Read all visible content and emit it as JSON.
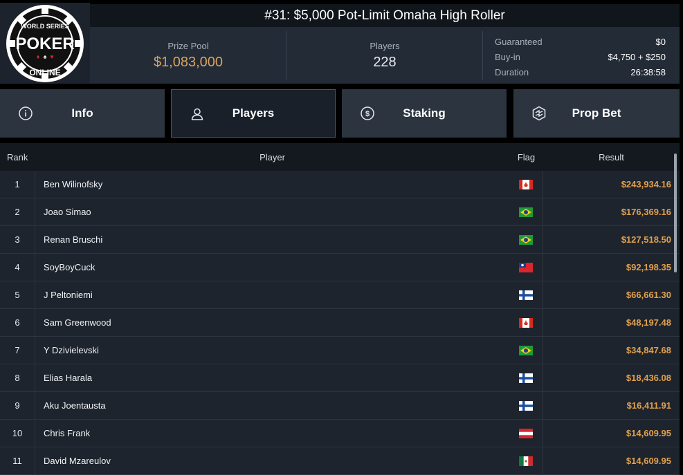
{
  "tournament": {
    "title": "#31: $5,000 Pot-Limit Omaha High Roller",
    "logo_text": [
      "WORLD SERIES",
      "POKER",
      "ONLINE"
    ]
  },
  "stats": {
    "prize_pool_label": "Prize Pool",
    "prize_pool_value": "$1,083,000",
    "players_label": "Players",
    "players_value": "228",
    "guaranteed_label": "Guaranteed",
    "guaranteed_value": "$0",
    "buyin_label": "Buy-in",
    "buyin_value": "$4,750 + $250",
    "duration_label": "Duration",
    "duration_value": "26:38:58"
  },
  "tabs": [
    {
      "label": "Info",
      "icon": "info-icon"
    },
    {
      "label": "Players",
      "icon": "user-icon",
      "active": true
    },
    {
      "label": "Staking",
      "icon": "dollar-icon"
    },
    {
      "label": "Prop Bet",
      "icon": "prop-bet-icon"
    }
  ],
  "table": {
    "headers": {
      "rank": "Rank",
      "player": "Player",
      "flag": "Flag",
      "result": "Result"
    },
    "rows": [
      {
        "rank": "1",
        "player": "Ben Wilinofsky",
        "flag": "canada",
        "result": "$243,934.16"
      },
      {
        "rank": "2",
        "player": "Joao Simao",
        "flag": "brazil",
        "result": "$176,369.16"
      },
      {
        "rank": "3",
        "player": "Renan Bruschi",
        "flag": "brazil",
        "result": "$127,518.50"
      },
      {
        "rank": "4",
        "player": "SoyBoyCuck",
        "flag": "taiwan",
        "result": "$92,198.35"
      },
      {
        "rank": "5",
        "player": "J Peltoniemi",
        "flag": "finland",
        "result": "$66,661.30"
      },
      {
        "rank": "6",
        "player": "Sam Greenwood",
        "flag": "canada",
        "result": "$48,197.48"
      },
      {
        "rank": "7",
        "player": "Y Dzivielevski",
        "flag": "brazil",
        "result": "$34,847.68"
      },
      {
        "rank": "8",
        "player": "Elias Harala",
        "flag": "finland",
        "result": "$18,436.08"
      },
      {
        "rank": "9",
        "player": "Aku Joentausta",
        "flag": "finland",
        "result": "$16,411.91"
      },
      {
        "rank": "10",
        "player": "Chris Frank",
        "flag": "austria",
        "result": "$14,609.95"
      },
      {
        "rank": "11",
        "player": "David Mzareulov",
        "flag": "mexico",
        "result": "$14,609.95"
      }
    ]
  },
  "colors": {
    "gold": "#d9a45f",
    "result": "#e0a04e",
    "panel": "#232b36"
  }
}
